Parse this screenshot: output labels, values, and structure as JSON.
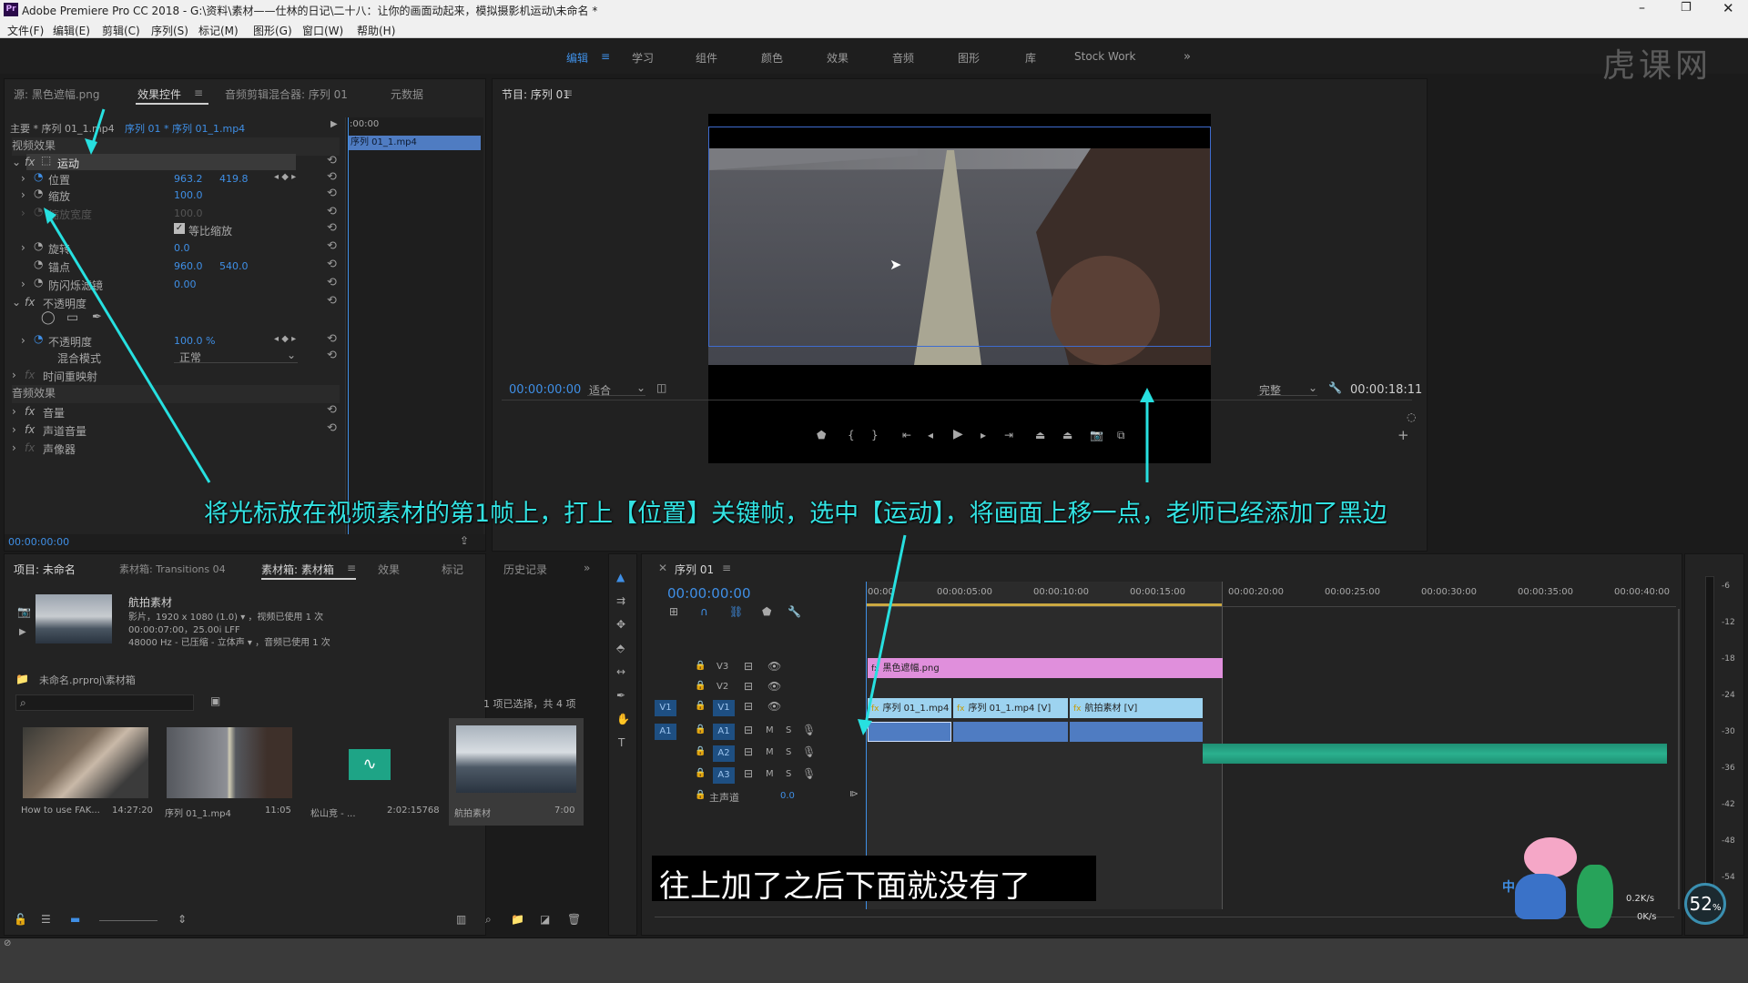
{
  "app": {
    "title": "Adobe Premiere Pro CC 2018 - G:\\资料\\素材——仕林的日记\\二十八：让你的画面动起来，模拟摄影机运动\\未命名 *",
    "badge": "Pr"
  },
  "menu": [
    "文件(F)",
    "编辑(E)",
    "剪辑(C)",
    "序列(S)",
    "标记(M)",
    "图形(G)",
    "窗口(W)",
    "帮助(H)"
  ],
  "workspaces": [
    "编辑",
    "学习",
    "组件",
    "颜色",
    "效果",
    "音频",
    "图形",
    "库",
    "Stock Work"
  ],
  "watermark": "虎课网",
  "effect_controls": {
    "tabs": [
      "源: 黑色遮幅.png",
      "效果控件",
      "音频剪辑混合器: 序列 01",
      "元数据"
    ],
    "master": "主要 * 序列 01_1.mp4",
    "clip_path": "序列 01 * 序列 01_1.mp4",
    "timecode_start": ":00:00",
    "clip_name": "序列 01_1.mp4",
    "video_effects_header": "视频效果",
    "motion": "运动",
    "position_label": "位置",
    "position_x": "963.2",
    "position_y": "419.8",
    "scale_label": "缩放",
    "scale_value": "100.0",
    "scale_width_label": "缩放宽度",
    "scale_width_value": "100.0",
    "uniform_scale": "等比缩放",
    "rotation_label": "旋转",
    "rotation_value": "0.0",
    "anchor_label": "锚点",
    "anchor_x": "960.0",
    "anchor_y": "540.0",
    "flicker_label": "防闪烁滤镜",
    "flicker_value": "0.00",
    "opacity_header": "不透明度",
    "opacity_label": "不透明度",
    "opacity_value": "100.0 %",
    "blend_label": "混合模式",
    "blend_value": "正常",
    "time_remap": "时间重映射",
    "audio_effects_header": "音频效果",
    "volume": "音量",
    "channel_volume": "声道音量",
    "panner": "声像器",
    "footer_timecode": "00:00:00:00"
  },
  "program_monitor": {
    "title": "节目: 序列 01",
    "timecode": "00:00:00:00",
    "fit": "适合",
    "quality": "完整",
    "duration": "00:00:18:11"
  },
  "caption_top": "将光标放在视频素材的第1帧上，打上【位置】关键帧，选中【运动】，将画面上移一点，老师已经添加了黑边",
  "caption_bottom": "往上加了之后下面就没有了",
  "project": {
    "tabs": [
      "项目: 未命名",
      "素材箱: Transitions 04",
      "素材箱: 素材箱",
      "效果",
      "标记",
      "历史记录"
    ],
    "clip_title": "航拍素材",
    "clip_info1": "影片，1920 x 1080 (1.0)  ▾ ，视频已使用 1 次",
    "clip_info2": "00:00:07:00，25.00i LFF",
    "clip_info3": "48000 Hz - 已压缩 - 立体声  ▾ ，音频已使用 1 次",
    "path": "未命名.prproj\\素材箱",
    "selection": "1 项已选择，共 4 项",
    "items": [
      {
        "name": "How to use FAK...",
        "dur": "14:27:20"
      },
      {
        "name": "序列 01_1.mp4",
        "dur": "11:05"
      },
      {
        "name": "松山竞 - ...",
        "dur": "2:02:15768"
      },
      {
        "name": "航拍素材",
        "dur": "7:00"
      }
    ]
  },
  "timeline": {
    "title": "序列 01",
    "timecode": "00:00:00:00",
    "ruler": [
      "00:00",
      "00:00:05:00",
      "00:00:10:00",
      "00:00:15:00",
      "00:00:20:00",
      "00:00:25:00",
      "00:00:30:00",
      "00:00:35:00",
      "00:00:40:00"
    ],
    "tracks": [
      "V3",
      "V2",
      "V1",
      "A1",
      "A2",
      "A3"
    ],
    "master_label": "主声道",
    "master_value": "0.0",
    "clip_v3": "黑色遮幅.png",
    "clip_v1a": "序列 01_1.mp4",
    "clip_v1b": "序列 01_1.mp4 [V]",
    "clip_v1c": "航拍素材 [V]"
  },
  "meter_labels": [
    "-6",
    "-12",
    "-18",
    "-24",
    "-30",
    "-36",
    "-42",
    "-48",
    "-54"
  ],
  "status": {
    "cpu": "52",
    "up": "0.2K/s",
    "down": "0K/s",
    "ime": "中"
  }
}
